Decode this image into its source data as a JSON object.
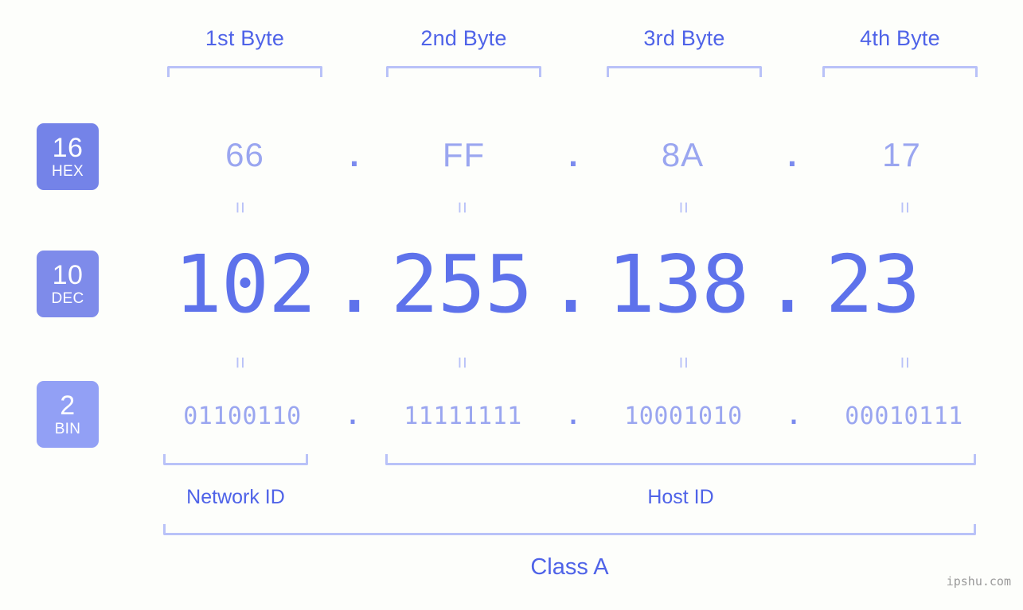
{
  "background_color": "#fdfefb",
  "accent_color": "#4f63e8",
  "bracket_color": "#b9c2f8",
  "byte_headers": [
    {
      "label": "1st Byte"
    },
    {
      "label": "2nd Byte"
    },
    {
      "label": "3rd Byte"
    },
    {
      "label": "4th Byte"
    }
  ],
  "rows": {
    "hex": {
      "badge_num": "16",
      "badge_tag": "HEX",
      "badge_color": "#7483e8",
      "text_color": "#9aa6f0",
      "values": [
        "66",
        "FF",
        "8A",
        "17"
      ],
      "separator": "."
    },
    "dec": {
      "badge_num": "10",
      "badge_tag": "DEC",
      "badge_color": "#7e8bea",
      "text_color": "#5e72eb",
      "values": [
        "102",
        "255",
        "138",
        "23"
      ],
      "separator": "."
    },
    "bin": {
      "badge_num": "2",
      "badge_tag": "BIN",
      "badge_color": "#92a0f5",
      "text_color": "#9aa6f0",
      "values": [
        "01100110",
        "11111111",
        "10001010",
        "00010111"
      ],
      "separator": "."
    }
  },
  "equals_marks": {
    "glyph": "=",
    "count_per_gap": 4
  },
  "segments": {
    "network_id": "Network ID",
    "host_id": "Host ID",
    "class": "Class A"
  },
  "watermark": "ipshu.com"
}
